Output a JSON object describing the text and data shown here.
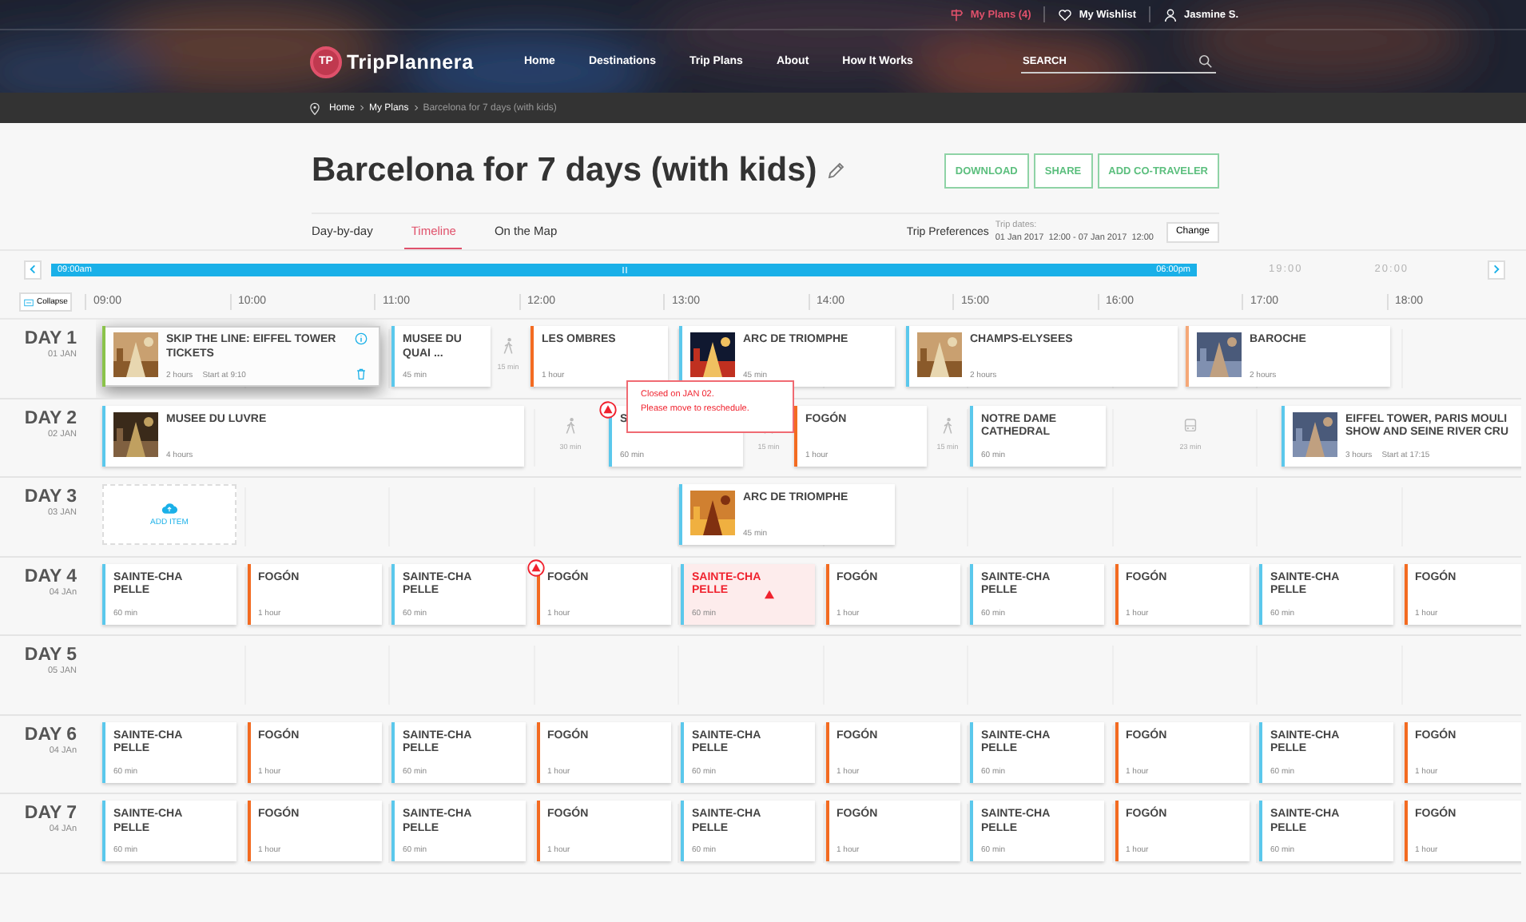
{
  "top_bar": {
    "my_plans": "My Plans (4)",
    "wishlist": "My Wishlist",
    "user": "Jasmine S."
  },
  "nav": {
    "logo_mark": "TP",
    "logo": "TripPlannera",
    "links": [
      "Home",
      "Destinations",
      "Trip Plans",
      "About",
      "How It Works"
    ],
    "search": {
      "placeholder": "SEARCH"
    }
  },
  "breadcrumbs": [
    "Home",
    "My Plans",
    "Barcelona for 7 days (with kids)"
  ],
  "plan": {
    "title": "Barcelona for 7 days (with kids)",
    "actions": [
      "DOWNLOAD",
      "SHARE",
      "ADD CO-TRAVELER"
    ],
    "tabs": [
      {
        "label": "Day-by-day",
        "selected": false
      },
      {
        "label": "Timeline",
        "selected": true
      },
      {
        "label": "On the Map",
        "selected": false
      }
    ],
    "trip_preferences": "Trip Preferences",
    "trip_dates_label": "Trip dates:",
    "trip_dates": "01 Jan 2017  12:00 - 07 Jan 2017  12:00",
    "change": "Change"
  },
  "range": {
    "start": "09:00am",
    "end": "06:00pm",
    "beyond": [
      "19:00",
      "20:00"
    ]
  },
  "timeline": {
    "collapse": "Collapse",
    "hours": [
      "09:00",
      "10:00",
      "11:00",
      "12:00",
      "13:00",
      "14:00",
      "15:00",
      "16:00",
      "17:00",
      "18:00"
    ],
    "days": [
      {
        "label": "DAY 1",
        "date": "01 JAN",
        "items": [
          {
            "kind": "activity",
            "title": "SKIP THE LINE: EIFFEL TOWER\nTICKETS",
            "duration": "2 hours",
            "start": "Start at 9:10",
            "color": "#8bc34a",
            "photo": true,
            "selected": true,
            "warning": false,
            "closed": false
          },
          {
            "kind": "activity",
            "title": "MUSEE DU\nQUAI ...",
            "duration": "45 min",
            "color": "#5bc8ec",
            "photo": false,
            "selected": false,
            "warning": false,
            "closed": false
          },
          {
            "kind": "walk",
            "duration": "15 min"
          },
          {
            "kind": "activity",
            "title": "LES OMBRES",
            "duration": "1 hour",
            "color": "#f36b21",
            "photo": false,
            "selected": false,
            "warning": false,
            "closed": false
          },
          {
            "kind": "activity",
            "title": "ARC DE TRIOMPHE",
            "duration": "45 min",
            "color": "#5bc8ec",
            "photo": true,
            "selected": false,
            "warning": false,
            "closed": false
          },
          {
            "kind": "activity",
            "title": "CHAMPS-ELYSEES",
            "duration": "2 hours",
            "color": "#5bc8ec",
            "photo": true,
            "selected": false,
            "warning": false,
            "closed": false
          },
          {
            "kind": "activity",
            "title": "BAROCHE",
            "duration": "2 hours",
            "color": "#f5a878",
            "photo": true,
            "selected": false,
            "warning": false,
            "closed": false
          }
        ]
      },
      {
        "label": "DAY 2",
        "date": "02 JAN",
        "items": [
          {
            "kind": "activity",
            "title": "MUSEE DU LUVRE",
            "duration": "4 hours",
            "color": "#5bc8ec",
            "photo": true,
            "selected": false,
            "warning": false,
            "closed": false
          },
          {
            "kind": "walk",
            "duration": "30 min"
          },
          {
            "kind": "activity",
            "title": "S",
            "duration": "60 min",
            "color": "#5bc8ec",
            "photo": false,
            "selected": false,
            "warning": true,
            "closed": false
          },
          {
            "kind": "walk",
            "duration": "15 min"
          },
          {
            "kind": "activity",
            "title": "FOGÓN",
            "duration": "1 hour",
            "color": "#f36b21",
            "photo": false,
            "selected": false,
            "warning": false,
            "closed": false
          },
          {
            "kind": "walk",
            "duration": "15 min"
          },
          {
            "kind": "activity",
            "title": "NOTRE DAME\nCATHEDRAL",
            "duration": "60 min",
            "color": "#5bc8ec",
            "photo": false,
            "selected": false,
            "warning": false,
            "closed": false
          },
          {
            "kind": "bus",
            "duration": "23 min"
          },
          {
            "kind": "activity",
            "title": "EIFFEL TOWER, PARIS MOULI\nSHOW AND SEINE RIVER CRU",
            "duration": "3 hours",
            "start": "Start at 17:15",
            "color": "#5bc8ec",
            "photo": true,
            "selected": false,
            "warning": false,
            "closed": false
          }
        ]
      },
      {
        "label": "DAY 3",
        "date": "03 JAN",
        "items": [
          {
            "kind": "add",
            "label": "ADD ITEM"
          },
          {
            "kind": "activity",
            "title": "ARC DE TRIOMPHE",
            "duration": "45 min",
            "color": "#5bc8ec",
            "photo": true,
            "selected": false,
            "warning": false,
            "closed": false
          }
        ]
      },
      {
        "label": "DAY 4",
        "date": "04 JAn",
        "items": [
          {
            "kind": "activity",
            "title": "SAINTE-CHA\nPELLE",
            "duration": "60 min",
            "color": "#5bc8ec",
            "photo": false,
            "selected": false,
            "warning": false,
            "closed": false
          },
          {
            "kind": "activity",
            "title": "FOGÓN",
            "duration": "1 hour",
            "color": "#f36b21",
            "photo": false,
            "selected": false,
            "warning": false,
            "closed": false
          },
          {
            "kind": "activity",
            "title": "SAINTE-CHA\nPELLE",
            "duration": "60 min",
            "color": "#5bc8ec",
            "photo": false,
            "selected": false,
            "warning": false,
            "closed": false
          },
          {
            "kind": "activity",
            "title": "FOGÓN",
            "duration": "1 hour",
            "color": "#f36b21",
            "photo": false,
            "selected": false,
            "warning": true,
            "closed": false
          },
          {
            "kind": "activity",
            "title": "SAINTE-CHA\nPELLE",
            "duration": "60 min",
            "color": "#5bc8ec",
            "photo": false,
            "selected": false,
            "warning": false,
            "closed": true
          },
          {
            "kind": "activity",
            "title": "FOGÓN",
            "duration": "1 hour",
            "color": "#f36b21",
            "photo": false,
            "selected": false,
            "warning": false,
            "closed": false
          },
          {
            "kind": "activity",
            "title": "SAINTE-CHA\nPELLE",
            "duration": "60 min",
            "color": "#5bc8ec",
            "photo": false,
            "selected": false,
            "warning": false,
            "closed": false
          },
          {
            "kind": "activity",
            "title": "FOGÓN",
            "duration": "1 hour",
            "color": "#f36b21",
            "photo": false,
            "selected": false,
            "warning": false,
            "closed": false
          },
          {
            "kind": "activity",
            "title": "SAINTE-CHA\nPELLE",
            "duration": "60 min",
            "color": "#5bc8ec",
            "photo": false,
            "selected": false,
            "warning": false,
            "closed": false
          },
          {
            "kind": "activity",
            "title": "FOGÓN",
            "duration": "1 hour",
            "color": "#f36b21",
            "photo": false,
            "selected": false,
            "warning": false,
            "closed": false
          }
        ]
      },
      {
        "label": "DAY 5",
        "date": "05 JAN"
      },
      {
        "label": "DAY 6",
        "date": "04 JAn",
        "items": [
          {
            "kind": "activity",
            "title": "SAINTE-CHA\nPELLE",
            "duration": "60 min",
            "color": "#5bc8ec",
            "photo": false,
            "selected": false,
            "warning": false,
            "closed": false
          },
          {
            "kind": "activity",
            "title": "FOGÓN",
            "duration": "1 hour",
            "color": "#f36b21",
            "photo": false,
            "selected": false,
            "warning": false,
            "closed": false
          },
          {
            "kind": "activity",
            "title": "SAINTE-CHA\nPELLE",
            "duration": "60 min",
            "color": "#5bc8ec",
            "photo": false,
            "selected": false,
            "warning": false,
            "closed": false
          },
          {
            "kind": "activity",
            "title": "FOGÓN",
            "duration": "1 hour",
            "color": "#f36b21",
            "photo": false,
            "selected": false,
            "warning": false,
            "closed": false
          },
          {
            "kind": "activity",
            "title": "SAINTE-CHA\nPELLE",
            "duration": "60 min",
            "color": "#5bc8ec",
            "photo": false,
            "selected": false,
            "warning": false,
            "closed": false
          },
          {
            "kind": "activity",
            "title": "FOGÓN",
            "duration": "1 hour",
            "color": "#f36b21",
            "photo": false,
            "selected": false,
            "warning": false,
            "closed": false
          },
          {
            "kind": "activity",
            "title": "SAINTE-CHA\nPELLE",
            "duration": "60 min",
            "color": "#5bc8ec",
            "photo": false,
            "selected": false,
            "warning": false,
            "closed": false
          },
          {
            "kind": "activity",
            "title": "FOGÓN",
            "duration": "1 hour",
            "color": "#f36b21",
            "photo": false,
            "selected": false,
            "warning": false,
            "closed": false
          },
          {
            "kind": "activity",
            "title": "SAINTE-CHA\nPELLE",
            "duration": "60 min",
            "color": "#5bc8ec",
            "photo": false,
            "selected": false,
            "warning": false,
            "closed": false
          },
          {
            "kind": "activity",
            "title": "FOGÓN",
            "duration": "1 hour",
            "color": "#f36b21",
            "photo": false,
            "selected": false,
            "warning": false,
            "closed": false
          }
        ]
      },
      {
        "label": "DAY 7",
        "date": "04 JAn",
        "items": [
          {
            "kind": "activity",
            "title": "SAINTE-CHA\nPELLE",
            "duration": "60 min",
            "color": "#5bc8ec",
            "photo": false,
            "selected": false,
            "warning": false,
            "closed": false
          },
          {
            "kind": "activity",
            "title": "FOGÓN",
            "duration": "1 hour",
            "color": "#f36b21",
            "photo": false,
            "selected": false,
            "warning": false,
            "closed": false
          },
          {
            "kind": "activity",
            "title": "SAINTE-CHA\nPELLE",
            "duration": "60 min",
            "color": "#5bc8ec",
            "photo": false,
            "selected": false,
            "warning": false,
            "closed": false
          },
          {
            "kind": "activity",
            "title": "FOGÓN",
            "duration": "1 hour",
            "color": "#f36b21",
            "photo": false,
            "selected": false,
            "warning": false,
            "closed": false
          },
          {
            "kind": "activity",
            "title": "SAINTE-CHA\nPELLE",
            "duration": "60 min",
            "color": "#5bc8ec",
            "photo": false,
            "selected": false,
            "warning": false,
            "closed": false
          },
          {
            "kind": "activity",
            "title": "FOGÓN",
            "duration": "1 hour",
            "color": "#f36b21",
            "photo": false,
            "selected": false,
            "warning": false,
            "closed": false
          },
          {
            "kind": "activity",
            "title": "SAINTE-CHA\nPELLE",
            "duration": "60 min",
            "color": "#5bc8ec",
            "photo": false,
            "selected": false,
            "warning": false,
            "closed": false
          },
          {
            "kind": "activity",
            "title": "FOGÓN",
            "duration": "1 hour",
            "color": "#f36b21",
            "photo": false,
            "selected": false,
            "warning": false,
            "closed": false
          },
          {
            "kind": "activity",
            "title": "SAINTE-CHA\nPELLE",
            "duration": "60 min",
            "color": "#5bc8ec",
            "photo": false,
            "selected": false,
            "warning": false,
            "closed": false
          },
          {
            "kind": "activity",
            "title": "FOGÓN",
            "duration": "1 hour",
            "color": "#f36b21",
            "photo": false,
            "selected": false,
            "warning": false,
            "closed": false
          }
        ]
      }
    ]
  },
  "tooltip": {
    "lines": [
      "Closed on JAN 02.",
      "Please move to reschedule."
    ]
  }
}
